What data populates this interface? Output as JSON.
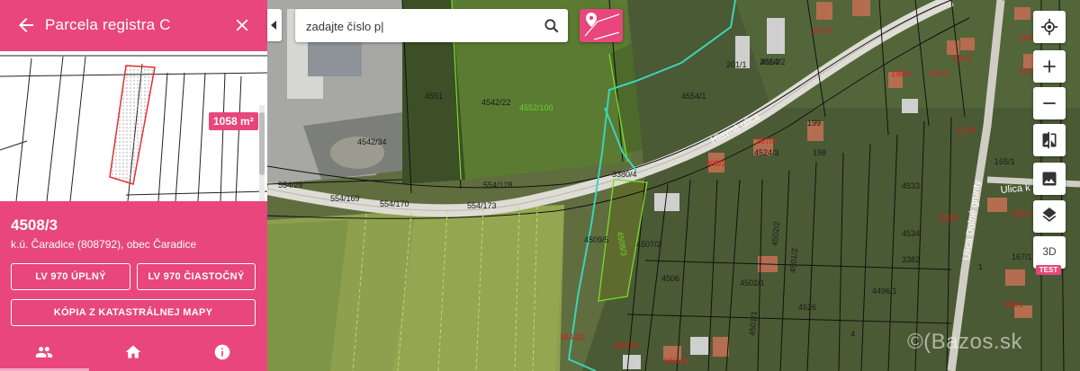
{
  "panel": {
    "title": "Parcela registra C",
    "area_badge": "1058 m²",
    "parcel_id": "4508/3",
    "parcel_desc": "k.ú. Čaradice (808792), obec Čaradice",
    "buttons": {
      "lv_full": "LV 970 ÚPLNÝ",
      "lv_partial": "LV 970 ČIASTOČNÝ",
      "copy_map": "KÓPIA Z KATASTRÁLNEJ MAPY"
    },
    "tabs": [
      "people-icon",
      "home-icon",
      "info-icon"
    ],
    "accent": "#e8467c"
  },
  "search": {
    "value": "zadajte číslo p|"
  },
  "map": {
    "parcel_labels": [
      "4551",
      "4542/22",
      "4552/100",
      "4554/1",
      "4542/34",
      "554/29",
      "554/128",
      "554/169",
      "554/170",
      "554/173",
      "3380/4",
      "4509/5",
      "4508/3",
      "4507/2",
      "4506",
      "4502/1",
      "4502/2",
      "4501/1",
      "4501/2",
      "4496/1",
      "4534",
      "4533",
      "3382",
      "201/1",
      "201/2",
      "4554/2",
      "207/3",
      "4524/3",
      "308/2",
      "307/4",
      "198",
      "199",
      "198/8",
      "197/6",
      "196/2",
      "162/2",
      "162/1",
      "312/4",
      "165/1",
      "166/1",
      "167/1",
      "168/1",
      "328/5",
      "1",
      "4526",
      "4",
      "184/22",
      "185/20",
      "186/18"
    ],
    "street_labels": [
      "Hlavná ulica",
      "Ulica k ihrisku",
      "Ulica Dolné grunty"
    ]
  },
  "controls": {
    "items": [
      "locate-icon",
      "zoom-in-icon",
      "zoom-out-icon",
      "compare-icon",
      "photo-icon",
      "layers-icon"
    ],
    "three_d": "3D",
    "test_badge": "TEST"
  },
  "watermark": "©(Bazos.sk"
}
